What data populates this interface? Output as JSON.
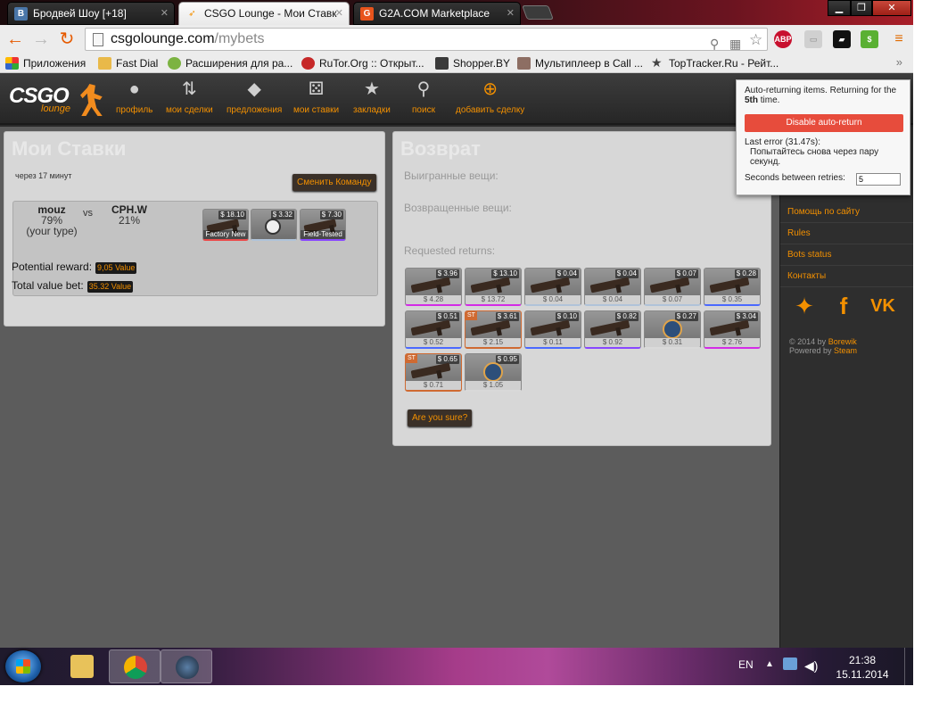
{
  "browser": {
    "tabs": [
      {
        "title": "Бродвей Шоу [+18]",
        "icon": "vk-icon",
        "color": "#4a76a8"
      },
      {
        "title": "CSGO Lounge - Мои Ставк",
        "icon": "csgolounge-icon",
        "color": "#f39000"
      },
      {
        "title": "G2A.COM Marketplace",
        "icon": "g2a-icon",
        "color": "#e8541c"
      }
    ],
    "url_host": "csgolounge.com",
    "url_path": "/mybets",
    "ext_abp": "ABP",
    "bookmarks": [
      "Приложения",
      "Fast Dial",
      "Расширения для ра...",
      "RuTor.Org :: Открыт...",
      "Shopper.BY",
      "Мультиплеер в Call ...",
      "TopTracker.Ru - Рейт..."
    ],
    "bookmarks_more": "»"
  },
  "site": {
    "logo": {
      "main": "CSGO",
      "sub": "lounge"
    },
    "nav": [
      "профиль",
      "мои сделки",
      "предложения",
      "мои ставки",
      "закладки",
      "поиск",
      "добавить сделку"
    ],
    "bets": {
      "title": "Мои Ставки",
      "timer": "через 17 минут",
      "change_team": "Сменить Команду",
      "team1": {
        "name": "mouz",
        "pct": "79%",
        "note": "(your type)"
      },
      "vs": "vs",
      "team2": {
        "name": "CPH.W",
        "pct": "21%"
      },
      "items": [
        {
          "price": "$ 18.10",
          "cond": "Factory New",
          "rarity": "#eb4b4b"
        },
        {
          "price": "$ 3.32",
          "cond": "",
          "rarity": "#b0c3d9"
        },
        {
          "price": "$ 7.30",
          "cond": "Field-Tested",
          "rarity": "#8847ff"
        }
      ],
      "potential_label": "Potential reward:",
      "potential_value": "9,05 Value",
      "total_label": "Total value bet:",
      "total_value": "35.32 Value"
    },
    "returns": {
      "title": "Возврат",
      "won": "Выигранные вещи:",
      "returned": "Возвращенные вещи:",
      "requested": "Requested returns:",
      "confirm": "Are you sure?",
      "items": [
        {
          "price": "$ 3.96",
          "below": "$ 4.28",
          "rarity": "#d32ce6",
          "st": false
        },
        {
          "price": "$ 13.10",
          "below": "$ 13.72",
          "rarity": "#d32ce6",
          "st": false
        },
        {
          "price": "$ 0.04",
          "below": "$ 0.04",
          "rarity": "#b0c3d9",
          "st": false
        },
        {
          "price": "$ 0.04",
          "below": "$ 0.04",
          "rarity": "#b0c3d9",
          "st": false
        },
        {
          "price": "$ 0.07",
          "below": "$ 0.07",
          "rarity": "#b0c3d9",
          "st": false
        },
        {
          "price": "$ 0.28",
          "below": "$ 0.35",
          "rarity": "#4b69ff",
          "st": false
        },
        {
          "price": "$ 0.51",
          "below": "$ 0.52",
          "rarity": "#4b69ff",
          "st": false
        },
        {
          "price": "$ 3.61",
          "below": "$ 2.15",
          "rarity": "#cf6a32",
          "st": true
        },
        {
          "price": "$ 0.10",
          "below": "$ 0.11",
          "rarity": "#4b69ff",
          "st": false
        },
        {
          "price": "$ 0.82",
          "below": "$ 0.92",
          "rarity": "#8847ff",
          "st": false
        },
        {
          "price": "$ 0.27",
          "below": "$ 0.31",
          "rarity": "#d9d9d9",
          "st": false
        },
        {
          "price": "$ 3.04",
          "below": "$ 2.76",
          "rarity": "#d32ce6",
          "st": false
        },
        {
          "price": "$ 0.65",
          "below": "$ 0.71",
          "rarity": "#8847ff",
          "st": true
        },
        {
          "price": "$ 0.95",
          "below": "$ 1.05",
          "rarity": "#d9d9d9",
          "st": false
        }
      ]
    },
    "right": {
      "links": [
        "Помощь по сайту",
        "Rules",
        "Bots status",
        "Контакты"
      ],
      "copyright": "© 2014 by",
      "author": "Borewik",
      "powered": "Powered by",
      "steam": "Steam"
    }
  },
  "popup": {
    "line1": "Auto-returning items. Returning for the",
    "times": "5th",
    "line1_end": "time.",
    "disable": "Disable auto-return",
    "error_label": "Last error (31.47s):",
    "error_msg": "Попытайтесь снова через пару секунд.",
    "seconds_label": "Seconds between retries:",
    "seconds_value": "5"
  },
  "taskbar": {
    "lang": "EN",
    "time": "21:38",
    "date": "15.11.2014"
  },
  "colors": {
    "accent": "#f39000",
    "danger": "#e74c3c"
  }
}
